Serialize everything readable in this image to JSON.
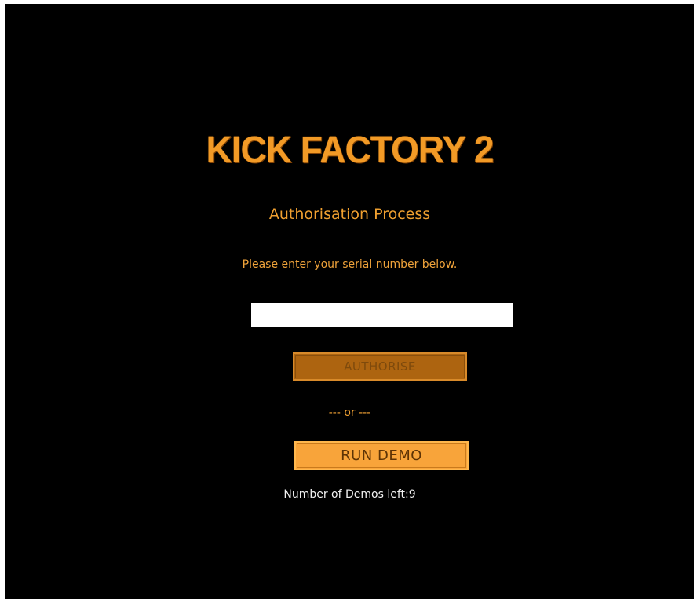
{
  "app": {
    "logo_text": "KICK FACTORY 2",
    "subtitle": "Authorisation Process",
    "instruction": "Please enter your serial number below."
  },
  "serial_field": {
    "value": "",
    "placeholder": ""
  },
  "buttons": {
    "authorise_label": "AUTHORISE",
    "or_divider": "--- or ---",
    "run_demo_label": "RUN DEMO"
  },
  "demos": {
    "remaining_text": "Number of Demos left:9",
    "remaining_count": 9
  },
  "colors": {
    "background": "#000000",
    "accent": "#f29a26",
    "authorise_bg": "#ad6410",
    "run_demo_bg": "#f8a43a"
  }
}
